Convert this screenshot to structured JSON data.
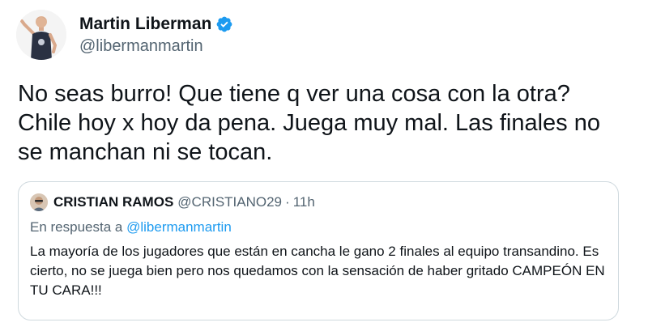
{
  "author": {
    "display_name": "Martin Liberman",
    "handle": "@libermanmartin",
    "verified_icon": "verified-badge-icon",
    "accent": "#1d9bf0"
  },
  "tweet": {
    "text": "No seas burro! Que tiene q ver una cosa con la otra?\nChile hoy x hoy da pena. Juega muy mal. Las finales no\nse manchan ni se tocan."
  },
  "quoted_tweet": {
    "display_name": "CRISTIAN RAMOS",
    "handle": "@CRISTIANO29",
    "separator": "·",
    "time": "11h",
    "reply_prefix": "En respuesta a",
    "reply_handle": "@libermanmartin",
    "text": "La mayoría de los jugadores que están en cancha le gano 2 finales al equipo transandino. Es cierto, no se juega bien pero nos quedamos con la sensación de haber gritado CAMPEÓN EN TU CARA!!!"
  }
}
